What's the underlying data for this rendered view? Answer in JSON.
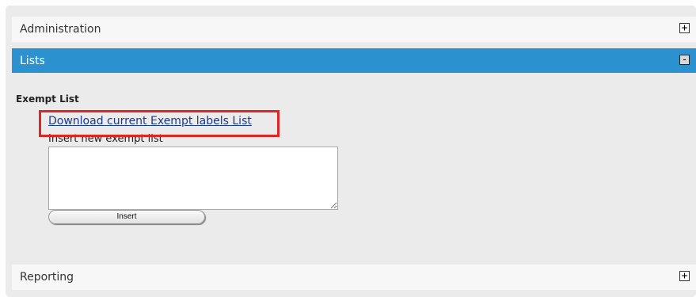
{
  "panels": {
    "administration": {
      "title": "Administration",
      "toggle": "+"
    },
    "lists": {
      "title": "Lists",
      "toggle": "-"
    },
    "reporting": {
      "title": "Reporting",
      "toggle": "+"
    }
  },
  "lists": {
    "section_label": "Exempt List",
    "download_link": "Download current Exempt labels List",
    "insert_label": "Insert new exempt list",
    "textarea_value": "",
    "insert_button": "Insert"
  },
  "colors": {
    "header_active": "#2b92cf",
    "highlight": "#e02525"
  }
}
